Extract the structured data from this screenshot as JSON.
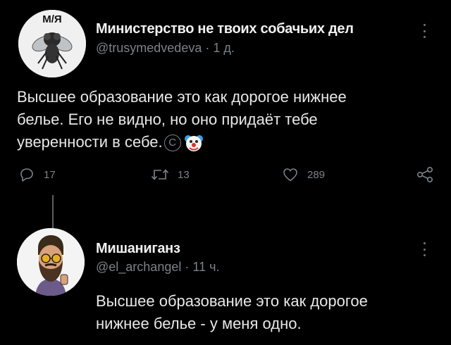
{
  "tweet": {
    "author_name": "Министерство не твоих собачьих дел",
    "handle": "@trusymedvedeva",
    "separator": "·",
    "time": "1 д.",
    "text_line1": "Высшее образование это как дорогое нижнее",
    "text_line2": "белье. Его не видно, но оно придаёт тебе",
    "text_line3": "уверенности в себе.",
    "copyright_symbol": "C",
    "replies": "17",
    "retweets": "13",
    "likes": "289",
    "avatar_icon": "fly-icon",
    "avatar_partial_text": "М/Я",
    "emoji_icon": "clown-face-icon"
  },
  "reply": {
    "author_name": "Мишаниганз",
    "handle": "@el_archangel",
    "separator": "·",
    "time": "11 ч.",
    "text_line1": "Высшее образование это как дорогое",
    "text_line2": "нижнее белье - у меня одно.",
    "avatar_icon": "bearded-man-icon"
  },
  "colors": {
    "background": "#000000",
    "text": "#e7e9ea",
    "secondary": "#7b8287"
  }
}
